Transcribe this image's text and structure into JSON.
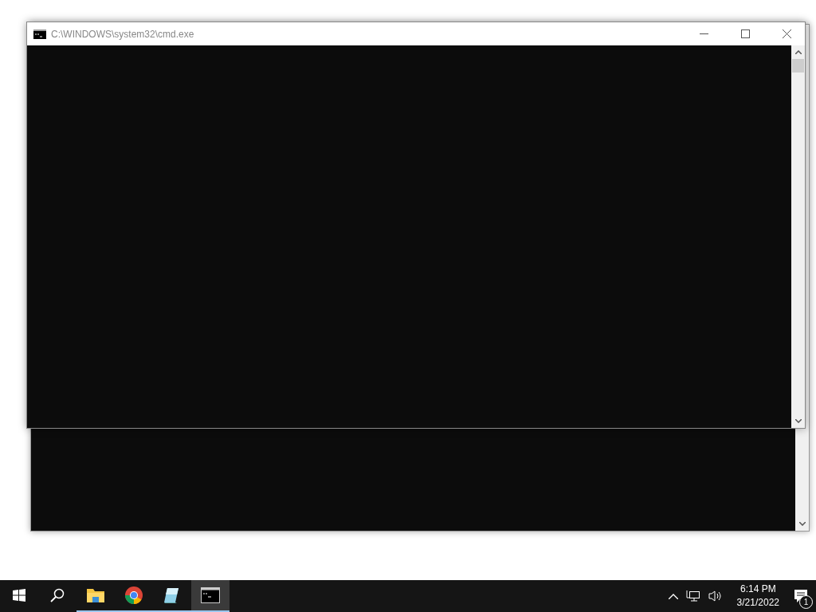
{
  "window": {
    "title": "C:\\WINDOWS\\system32\\cmd.exe"
  },
  "taskbar": {
    "apps": [
      {
        "kind": "explorer",
        "running": true,
        "selected": false
      },
      {
        "kind": "chrome",
        "running": true,
        "selected": false
      },
      {
        "kind": "notes",
        "running": true,
        "selected": false
      },
      {
        "kind": "terminal",
        "running": true,
        "selected": true
      }
    ],
    "time": "6:14 PM",
    "date": "3/21/2022",
    "notification_count": "1"
  }
}
